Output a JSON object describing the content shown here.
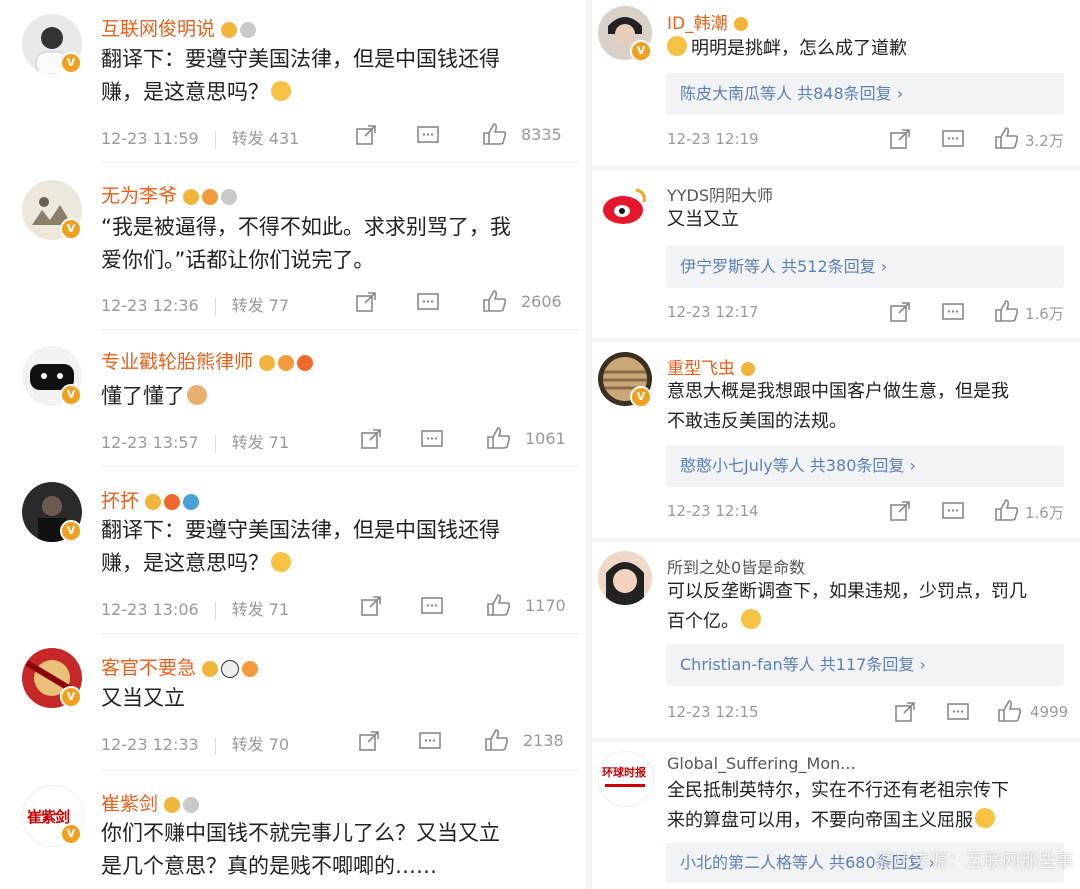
{
  "left": [
    {
      "name": "互联网俊明说",
      "lines": [
        "翻译下：要遵守美国法律，但是中国钱还得",
        "赚，是这意思吗？"
      ],
      "time": "12-23 11:59",
      "repost": "转发 431",
      "likes": "8335"
    },
    {
      "name": "无为李爷",
      "lines": [
        "“我是被逼得，不得不如此。求求别骂了，我",
        "爱你们。”话都让你们说完了。"
      ],
      "time": "12-23 12:36",
      "repost": "转发 77",
      "likes": "2606"
    },
    {
      "name": "专业戳轮胎熊律师",
      "lines": [
        "懂了懂了"
      ],
      "time": "12-23 13:57",
      "repost": "转发 71",
      "likes": "1061"
    },
    {
      "name": "抔抔",
      "lines": [
        "翻译下：要遵守美国法律，但是中国钱还得",
        "赚，是这意思吗？"
      ],
      "time": "12-23 13:06",
      "repost": "转发 71",
      "likes": "1170"
    },
    {
      "name": "客官不要急",
      "lines": [
        "又当又立"
      ],
      "time": "12-23 12:33",
      "repost": "转发 70",
      "likes": "2138"
    },
    {
      "name": "崔紫剑",
      "avatar_text": "崔紫剑",
      "lines": [
        "你们不赚中国钱不就完事儿了么？又当又立",
        "是几个意思？真的是贱不唧唧的……"
      ]
    }
  ],
  "right": [
    {
      "name": "ID_韩潮",
      "lines": [
        "明明是挑衅，怎么成了道歉"
      ],
      "reply": "陈皮大南瓜等人  共848条回复 ›",
      "time": "12-23 12:19",
      "likes": "3.2万"
    },
    {
      "name": "YYDS阴阳大师",
      "lines": [
        "又当又立"
      ],
      "reply": "伊宁罗斯等人  共512条回复 ›",
      "time": "12-23 12:17",
      "likes": "1.6万"
    },
    {
      "name": "重型飞虫",
      "lines": [
        "意思大概是我想跟中国客户做生意，但是我",
        "不敢违反美国的法规。"
      ],
      "reply": "憨憨小七July等人  共380条回复 ›",
      "time": "12-23 12:14",
      "likes": "1.6万"
    },
    {
      "name": "所到之处0皆是命数",
      "lines": [
        "可以反垄断调查下，如果违规，少罚点，罚几",
        "百个亿。"
      ],
      "reply": "Christian-fan等人  共117条回复 ›",
      "time": "12-23 12:15",
      "likes": "4999"
    },
    {
      "name": "Global_Suffering_Mon...",
      "avatar_text": "环球时报",
      "lines": [
        "全民抵制英特尔，实在不行还有老祖宗传下",
        "来的算盘可以用，不要向帝国主义屈服"
      ],
      "reply": "小北的第二人格等人  共680条回复 ›"
    }
  ],
  "watermark": "图片来源：互联网那些事",
  "colors": {
    "name_orange": "#e8611c",
    "link_blue": "#5b7fb8",
    "meta_gray": "#999999",
    "reply_bg": "#f2f3f5"
  }
}
